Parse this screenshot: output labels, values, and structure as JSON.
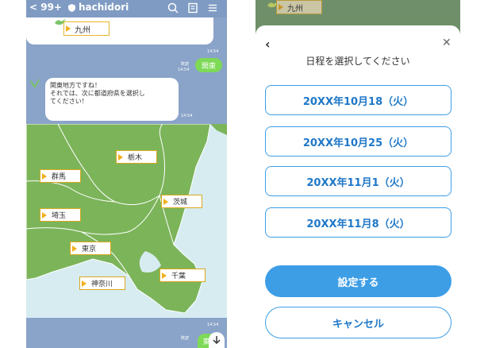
{
  "left_phone": {
    "header": {
      "back_label": "< 99+",
      "title": "hachidori"
    },
    "top_button": "九州",
    "times": [
      "14:54",
      "14:54",
      "14:54",
      "14:54"
    ],
    "read_label": "既読",
    "user_msg_1": "関東",
    "bot_msg": {
      "line1": "関東地方ですね！",
      "line2": "それでは、次に都道府県を選択し",
      "line3": "てください！"
    },
    "map_prefectures": [
      "栃木",
      "群馬",
      "茨城",
      "埼玉",
      "東京",
      "千葉",
      "神奈川"
    ],
    "user_msg_2": "東"
  },
  "right_phone": {
    "top_button": "九州",
    "sheet_title": "日程を選択してください",
    "date_options": [
      "20XX年10月18（火）",
      "20XX年10月25（火）",
      "20XX年11月1（火）",
      "20XX年11月8（火）"
    ],
    "set_button": "設定する",
    "cancel_button": "キャンセル"
  },
  "colors": {
    "accent": "#3d9ee6",
    "chat_bg": "#8aa3c8",
    "user_bubble": "#7ed957",
    "map_land": "#7cb45a",
    "map_sea": "#d6ecf1",
    "button_border": "#e7b52a"
  },
  "icons": [
    "back-icon",
    "shield-icon",
    "search-icon",
    "note-icon",
    "menu-icon",
    "bot-avatar-icon",
    "close-icon",
    "chevron-left-icon",
    "scroll-down-icon"
  ]
}
